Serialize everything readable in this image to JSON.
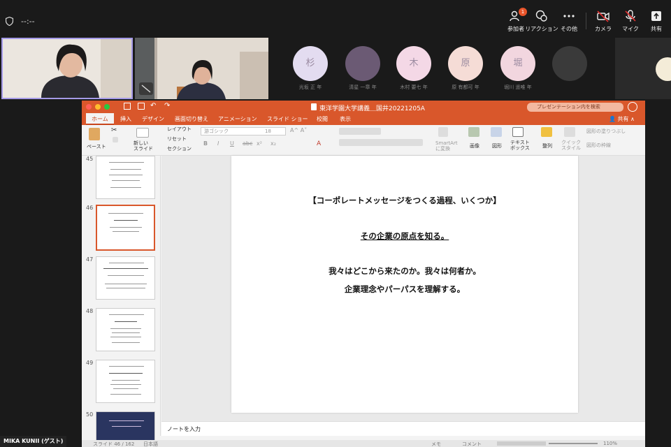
{
  "zoom": {
    "timer": "--:--",
    "tools": [
      {
        "label": "参加者",
        "icon": "participants-icon",
        "badge": "1"
      },
      {
        "label": "リアクション",
        "icon": "reaction-icon"
      },
      {
        "label": "その他",
        "icon": "more-icon"
      },
      {
        "label": "カメラ",
        "icon": "camera-icon"
      },
      {
        "label": "マイク",
        "icon": "mic-icon"
      },
      {
        "label": "共有",
        "icon": "share-icon"
      }
    ],
    "participants": [
      {
        "initial": "杉",
        "name": "光坂 正 年"
      },
      {
        "initial": "",
        "name": "清星 一章 年"
      },
      {
        "initial": "木",
        "name": "木村 要七 年"
      },
      {
        "initial": "原",
        "name": "原 有都可 年"
      },
      {
        "initial": "堀",
        "name": "堀川 遥唯 年"
      },
      {
        "initial": "",
        "name": ""
      }
    ],
    "user_badge": "MIKA KUNII (ゲスト)"
  },
  "ppt": {
    "doc_title": "東洋学園大学講義＿国井20221205A",
    "search_placeholder": "プレゼンテーション内を検索",
    "share_label": "共有",
    "tabs": [
      "ホーム",
      "挿入",
      "デザイン",
      "画面切り替え",
      "アニメーション",
      "スライド ショー",
      "校閲",
      "表示"
    ],
    "ribbon": {
      "paste": "ペースト",
      "new_slide": "新しい\nスライド",
      "layout": "レイアウト",
      "reset": "リセット",
      "section": "セクション",
      "font": "游ゴシック",
      "size": "18",
      "smartart": "SmartArt\nに変換",
      "picture": "画像",
      "shape": "図形",
      "textbox": "テキスト\nボックス",
      "arrange": "整列",
      "quick_style": "クイック\nスタイル",
      "shape_fill": "図形の塗りつぶし",
      "shape_outline": "図形の枠線"
    },
    "thumb_numbers": [
      "45",
      "46",
      "47",
      "48",
      "49",
      "50"
    ],
    "slide": {
      "heading": "【コーポレートメッセージをつくる過程、いくつか】",
      "subheading": "その企業の原点を知る。",
      "line1": "我々はどこから来たのか。我々は何者か。",
      "line2": "企業理念やパーパスを理解する。"
    },
    "notes_placeholder": "ノートを入力",
    "status": {
      "slide_info": "スライド 46 / 162",
      "language": "日本語",
      "memo": "メモ",
      "comment": "コメント",
      "zoom": "110%"
    }
  }
}
